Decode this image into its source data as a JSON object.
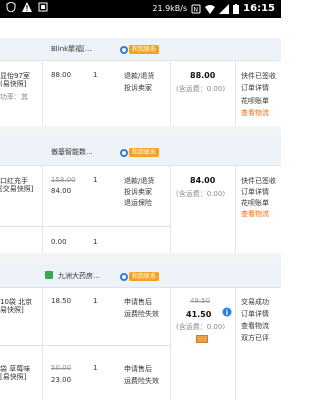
{
  "status_bar": {
    "speed": "21.9kB/s",
    "time": "16:15"
  },
  "orders": [
    {
      "shop": "Blink聚福[...",
      "contact": "和我联系",
      "product_lines": [
        "显怡97室",
        "(易快照]",
        "功率：其"
      ],
      "price": "88.00",
      "qty": "1",
      "actions": [
        "退款/退货",
        "投诉卖家"
      ],
      "total": "88.00",
      "shipping": "(含运费：0.00)",
      "status": [
        "快件已签收",
        "订单详情",
        "花呗账单",
        "查看物流"
      ]
    },
    {
      "shop": "傲基智能数...",
      "contact": "和我联系",
      "product_lines": [
        "口红充手",
        "[交易快照]"
      ],
      "original_price": "158.00",
      "price": "84.00",
      "qty": "1",
      "actions": [
        "退款/退货",
        "投诉卖家",
        "退运保险"
      ],
      "total": "84.00",
      "shipping": "(含运费：0.00)",
      "status": [
        "快件已签收",
        "订单详情",
        "花呗账单",
        "查看物流"
      ],
      "extra_price": "0.00",
      "extra_qty": "1"
    },
    {
      "shop": "九洲大药房...",
      "contact": "和我联系",
      "items": [
        {
          "product_lines": [
            "10袋 北京",
            "易快照]"
          ],
          "price": "18.50",
          "qty": "1",
          "actions": [
            "申请售后",
            "运费险失效"
          ]
        },
        {
          "product_lines": [
            "袋 草莓味",
            "[易快照]"
          ],
          "original_price": "50.00",
          "price": "23.00",
          "qty": "1",
          "actions": [
            "申请售后",
            "运费险失效"
          ]
        }
      ],
      "original_total": "49.50",
      "total": "41.50",
      "shipping": "(含运费：0.00)",
      "status": [
        "交易成功",
        "订单详情",
        "查看物流",
        "双方已评"
      ]
    }
  ]
}
